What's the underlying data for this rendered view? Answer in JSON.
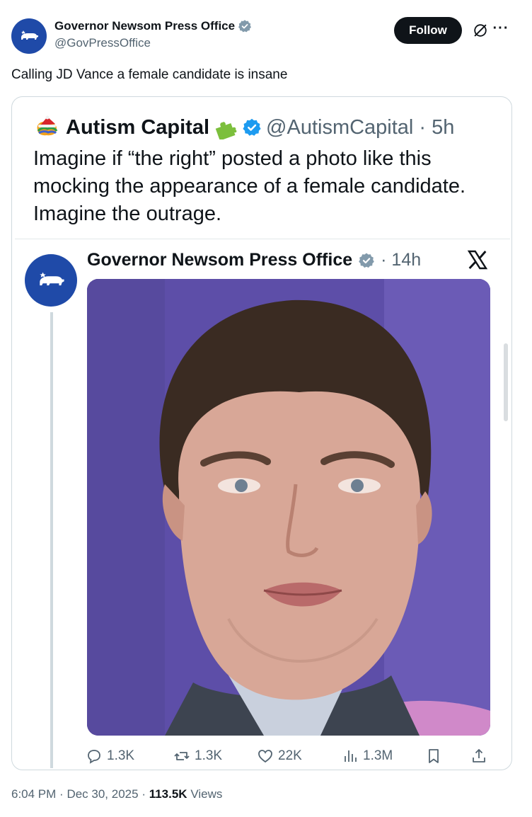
{
  "author": {
    "display_name": "Governor Newsom Press Office",
    "handle": "@GovPressOffice",
    "avatar_icon": "california-bear-icon",
    "verified_icon": "verified-badge-icon"
  },
  "header": {
    "follow_label": "Follow",
    "grok_icon": "grok-icon",
    "more_label": "···"
  },
  "tweet": {
    "text": "Calling JD Vance a female candidate is insane"
  },
  "quoted_screenshot": {
    "name": "Autism Capital",
    "handle_time": "@AutismCapital · 5h",
    "text": "Imagine if “the right” posted a photo like this mocking the appearance of a female candidate. Imagine the outrage.",
    "inner": {
      "name": "Governor Newsom Press Office",
      "time": "· 14h",
      "photo_icon": "portrait-photo"
    },
    "actions": {
      "replies": "1.3K",
      "reposts": "1.3K",
      "likes": "22K",
      "views": "1.3M"
    }
  },
  "footer": {
    "time": "6:04 PM",
    "date": "Dec 30, 2025",
    "views_count": "113.5K",
    "views_label": "Views"
  },
  "colors": {
    "text": "#0f1419",
    "secondary": "#536471",
    "verified": "#1d9bf0",
    "avatar_bg": "#1f4aa8"
  }
}
